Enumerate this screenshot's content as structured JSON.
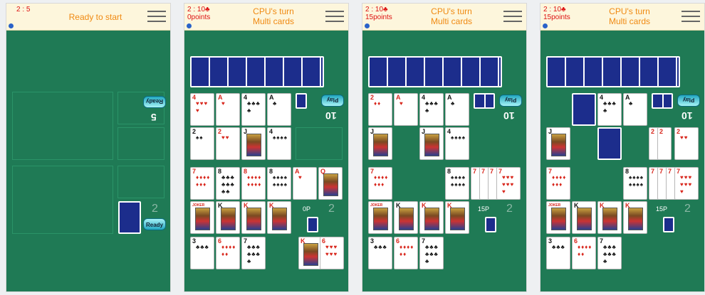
{
  "screens": [
    {
      "score": "2 : 5",
      "points": "",
      "title_line1": "Ready to start",
      "title_line2": "",
      "opponent_count": "5",
      "player_count": "2",
      "opponent_button": "Ready",
      "player_button": "Ready",
      "pot_label": ""
    },
    {
      "score": "2 : 10♣",
      "points": "0points",
      "title_line1": "CPU's turn",
      "title_line2": "Multi cards",
      "opponent_count": "10",
      "player_count": "2",
      "opponent_button": "Play",
      "player_button": "",
      "pot_label": "0P"
    },
    {
      "score": "2 : 10♣",
      "points": "15points",
      "title_line1": "CPU's turn",
      "title_line2": "Multi cards",
      "opponent_count": "10",
      "player_count": "2",
      "opponent_button": "Play",
      "player_button": "",
      "pot_label": "15P"
    },
    {
      "score": "2 : 10♣",
      "points": "15points",
      "title_line1": "CPU's turn",
      "title_line2": "Multi cards",
      "opponent_count": "10",
      "player_count": "2",
      "opponent_button": "Play",
      "player_button": "",
      "pot_label": "15P"
    }
  ],
  "cards": {
    "four_hearts": "4",
    "ace_hearts": "A",
    "four_clubs": "4",
    "ace_clubs": "A",
    "two_spades": "2",
    "two_hearts": "2",
    "jack_spades": "J",
    "four_spades": "4",
    "seven_diamonds": "7",
    "eight_clubs": "8",
    "eight_diamonds": "8",
    "eight_spades": "8",
    "ace_hearts_b": "A",
    "queen_hearts": "Q",
    "joker": "JOKER",
    "king_spades": "K",
    "king_hearts": "K",
    "king_diamonds": "K",
    "three_clubs": "3",
    "six_diamonds": "6",
    "seven_clubs": "7",
    "king_hearts_b": "K",
    "six_hearts": "6",
    "two_diamonds": "2",
    "seven_hearts": "7",
    "joker_b": "JOKER"
  }
}
